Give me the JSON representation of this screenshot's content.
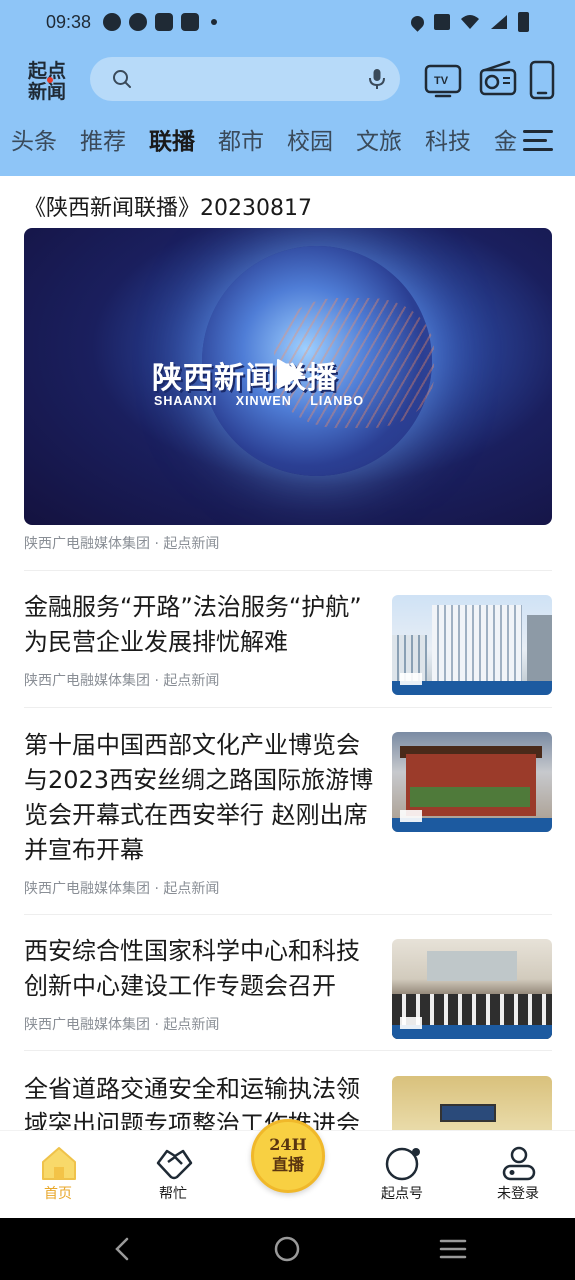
{
  "status_bar": {
    "time": "09:38"
  },
  "header": {
    "logo_text": "起点新闻",
    "search_placeholder": "",
    "icons": [
      "tv-icon",
      "radio-icon",
      "phone-icon"
    ]
  },
  "tabs": [
    {
      "label": "头条",
      "active": false
    },
    {
      "label": "推荐",
      "active": false
    },
    {
      "label": "联播",
      "active": true
    },
    {
      "label": "都市",
      "active": false
    },
    {
      "label": "校园",
      "active": false
    },
    {
      "label": "文旅",
      "active": false
    },
    {
      "label": "科技",
      "active": false
    },
    {
      "label": "金",
      "active": false
    }
  ],
  "featured": {
    "title": "《陕西新闻联播》20230817",
    "video_title_cn": "陕西新闻联播",
    "video_title_en": "SHAANXI XINWEN LIANBO",
    "source": "陕西广电融媒体集团 · 起点新闻"
  },
  "news": [
    {
      "title": "金融服务“开路”法治服务“护航” 为民营企业发展排忧解难",
      "source": "陕西广电融媒体集团 · 起点新闻"
    },
    {
      "title": "第十届中国西部文化产业博览会与2023西安丝绸之路国际旅游博览会开幕式在西安举行  赵刚出席并宣布开幕",
      "source": "陕西广电融媒体集团 · 起点新闻"
    },
    {
      "title": "西安综合性国家科学中心和科技创新中心建设工作专题会召开",
      "source": "陕西广电融媒体集团 · 起点新闻"
    },
    {
      "title": "全省道路交通安全和运输执法领域突出问题专项整治工作推进会",
      "source": ""
    }
  ],
  "bottom_nav": {
    "home": "首页",
    "help": "帮忙",
    "live_line1": "24H",
    "live_line2": "直播",
    "qidian": "起点号",
    "login": "未登录"
  },
  "colors": {
    "header_bg": "#8ec5f7",
    "active_nav": "#e8a72a",
    "live_button": "#f8d042"
  }
}
